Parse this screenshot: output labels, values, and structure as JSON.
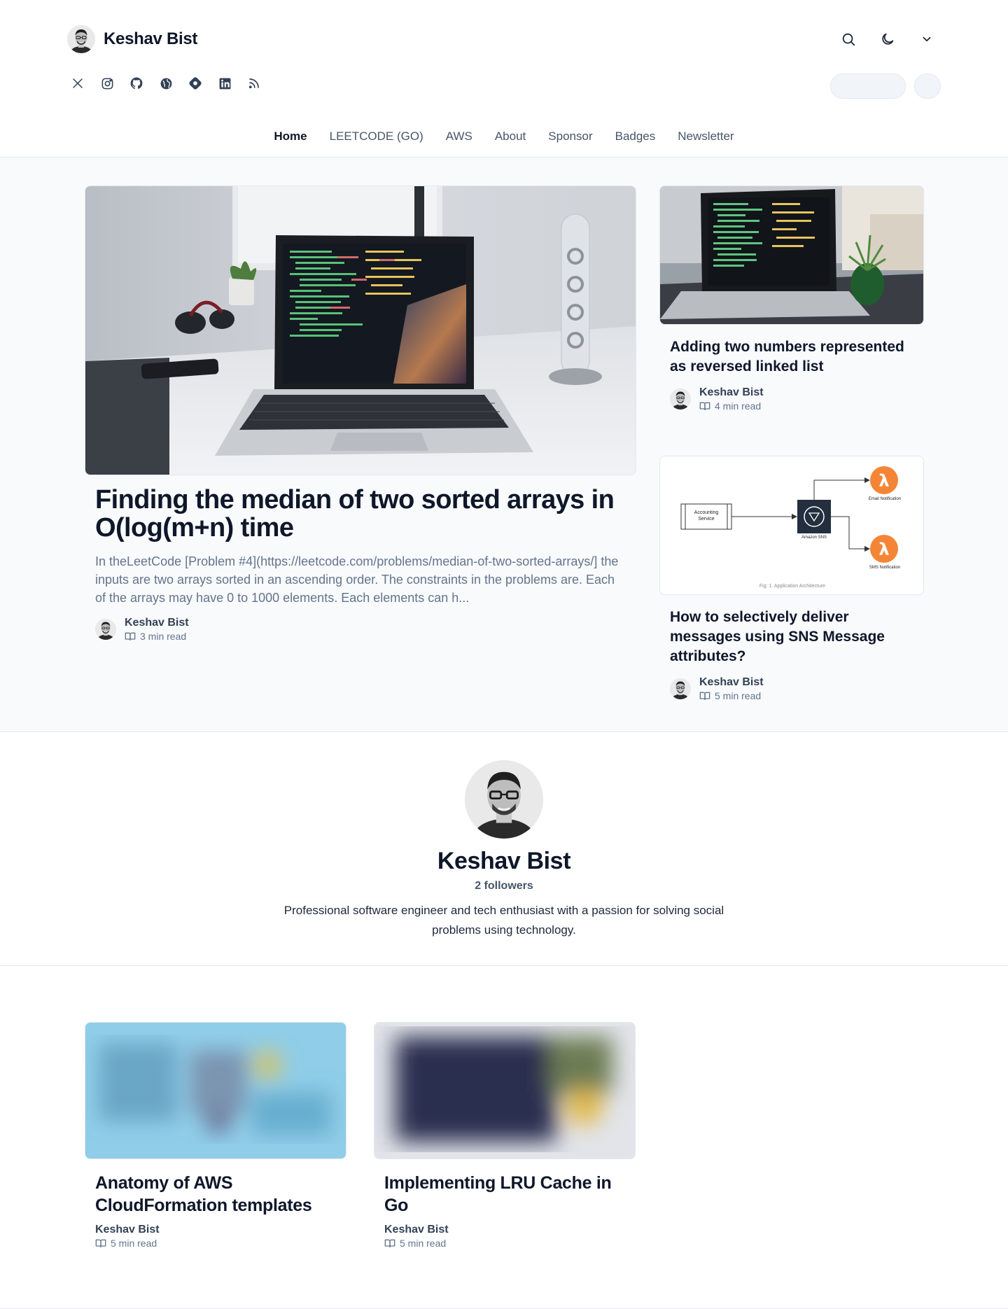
{
  "blog": {
    "name": "Keshav Bist"
  },
  "header": {
    "icons": [
      "search-icon",
      "moon-icon",
      "chevron-down-icon"
    ],
    "social": [
      "x-icon",
      "instagram-icon",
      "github-icon",
      "globe-icon",
      "hashnode-icon",
      "linkedin-icon",
      "rss-icon"
    ]
  },
  "nav": {
    "items": [
      "Home",
      "LEETCODE (GO)",
      "AWS",
      "About",
      "Sponsor",
      "Badges",
      "Newsletter"
    ],
    "active": "Home"
  },
  "featured": {
    "title": "Finding the median of two sorted arrays in O(log(m+n) time",
    "excerpt": "In theLeetCode [Problem #4](https://leetcode.com/problems/median-of-two-sorted-arrays/] the inputs are two arrays sorted in an ascending order. The constraints in the problems are. Each of the arrays may have 0 to 1000 elements. Each elements can h...",
    "author": "Keshav Bist",
    "read_time": "3 min read"
  },
  "side_posts": [
    {
      "title": "Adding two numbers represented as reversed linked list",
      "author": "Keshav Bist",
      "read_time": "4 min read"
    },
    {
      "title": "How to selectively deliver messages using SNS Message attributes?",
      "author": "Keshav Bist",
      "read_time": "5 min read",
      "diagram": {
        "source": "Accounting Service",
        "hub": "Amazon SNS",
        "targets": [
          "Email Notification",
          "SMS Notification"
        ],
        "caption": "Fig: 1. Application Architecture"
      }
    }
  ],
  "profile": {
    "name": "Keshav Bist",
    "followers": "2 followers",
    "bio": "Professional software engineer and tech enthusiast with a passion for solving social problems using technology."
  },
  "posts": [
    {
      "title": "Anatomy of AWS CloudFormation templates",
      "author": "Keshav Bist",
      "read_time": "5 min read"
    },
    {
      "title": "Implementing LRU Cache in Go",
      "author": "Keshav Bist",
      "read_time": "5 min read"
    }
  ],
  "colors": {
    "text": "#0f172a",
    "muted": "#64748b",
    "border": "#e2e8f0",
    "bg_soft": "#f8fafc",
    "lambda_orange": "#f58536"
  }
}
